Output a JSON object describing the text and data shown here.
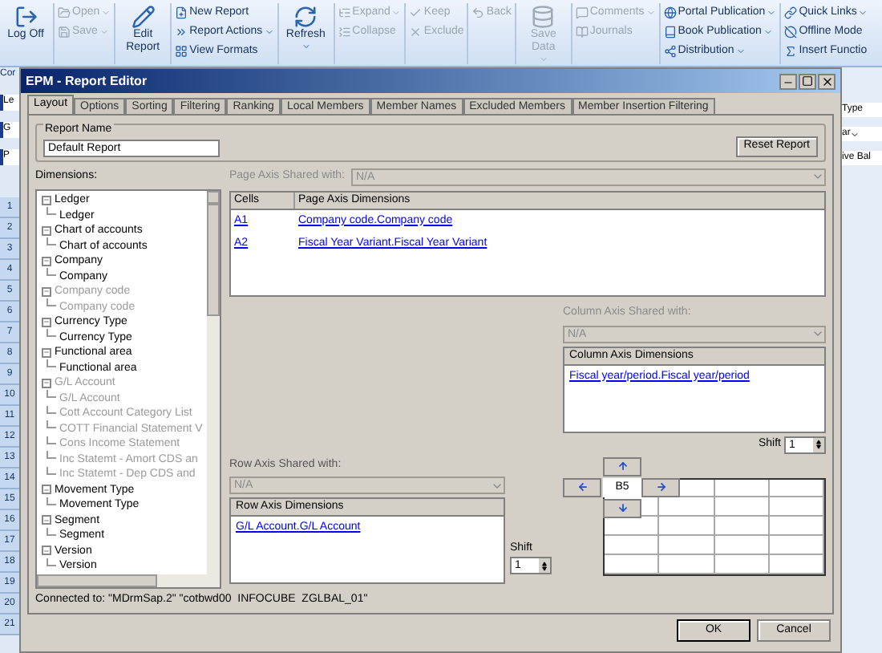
{
  "ribbon": {
    "groups": [
      {
        "items": [
          {
            "kind": "large",
            "label": "Log Off",
            "disabled": false,
            "dropdown": false
          }
        ]
      },
      {
        "items": [
          {
            "kind": "small",
            "label": "Open",
            "disabled": true,
            "dropdown": true
          },
          {
            "kind": "small",
            "label": "Save",
            "disabled": true,
            "dropdown": true
          }
        ]
      },
      {
        "items": [
          {
            "kind": "large",
            "label": "Edit Report",
            "disabled": false,
            "dropdown": false
          }
        ]
      },
      {
        "items": [
          {
            "kind": "small",
            "label": "New Report",
            "disabled": false,
            "dropdown": false
          },
          {
            "kind": "small",
            "label": "Report Actions",
            "disabled": false,
            "dropdown": true
          },
          {
            "kind": "small",
            "label": "View Formats",
            "disabled": false,
            "dropdown": false
          }
        ]
      },
      {
        "items": [
          {
            "kind": "large",
            "label": "Refresh",
            "disabled": false,
            "dropdown": true
          }
        ]
      },
      {
        "items": [
          {
            "kind": "small",
            "label": "Expand",
            "disabled": true,
            "dropdown": true
          },
          {
            "kind": "small",
            "label": "Collapse",
            "disabled": true,
            "dropdown": false
          }
        ]
      },
      {
        "items": [
          {
            "kind": "small",
            "label": "Keep",
            "disabled": true,
            "dropdown": false
          },
          {
            "kind": "small",
            "label": "Exclude",
            "disabled": true,
            "dropdown": false
          }
        ]
      },
      {
        "items": [
          {
            "kind": "small",
            "label": "Back",
            "disabled": true,
            "dropdown": false
          }
        ]
      },
      {
        "items": [
          {
            "kind": "large",
            "label": "Save Data",
            "disabled": true,
            "dropdown": true
          }
        ]
      },
      {
        "items": [
          {
            "kind": "small",
            "label": "Comments",
            "disabled": true,
            "dropdown": true
          },
          {
            "kind": "small",
            "label": "Journals",
            "disabled": true,
            "dropdown": false
          }
        ]
      },
      {
        "items": [
          {
            "kind": "small",
            "label": "Portal Publication",
            "disabled": false,
            "dropdown": true
          },
          {
            "kind": "small",
            "label": "Book Publication",
            "disabled": false,
            "dropdown": true
          },
          {
            "kind": "small",
            "label": "Distribution",
            "disabled": false,
            "dropdown": true
          }
        ]
      },
      {
        "items": [
          {
            "kind": "small",
            "label": "Quick Links",
            "disabled": false,
            "dropdown": true
          },
          {
            "kind": "small",
            "label": "Offline Mode",
            "disabled": false,
            "dropdown": false
          },
          {
            "kind": "small",
            "label": "Insert Functio",
            "disabled": false,
            "dropdown": false
          }
        ]
      }
    ]
  },
  "sheet": {
    "left_tab": "Cor",
    "left_fields": [
      "Le",
      "G",
      "P"
    ],
    "row_numbers": [
      "1",
      "2",
      "3",
      "4",
      "5",
      "6",
      "7",
      "8",
      "9",
      "10",
      "11",
      "12",
      "13",
      "14",
      "15",
      "16",
      "17",
      "18",
      "19",
      "20",
      "21"
    ],
    "right_label": "Type",
    "right_field": "ar",
    "right_text": "ive Bal"
  },
  "dialog": {
    "title": "EPM - Report Editor",
    "tabs": [
      {
        "label": "Layout",
        "selected": true
      },
      {
        "label": "Options",
        "selected": false
      },
      {
        "label": "Sorting",
        "selected": false
      },
      {
        "label": "Filtering",
        "selected": false
      },
      {
        "label": "Ranking",
        "selected": false
      },
      {
        "label": "Local Members",
        "selected": false
      },
      {
        "label": "Member Names",
        "selected": false
      },
      {
        "label": "Excluded Members",
        "selected": false
      },
      {
        "label": "Member Insertion Filtering",
        "selected": false
      }
    ],
    "report_name": {
      "label": "Report Name",
      "value": "Default Report"
    },
    "reset_button": "Reset Report",
    "dimensions": {
      "label": "Dimensions:",
      "tree": [
        {
          "label": "Ledger",
          "disabled": false,
          "children": [
            {
              "label": "Ledger",
              "disabled": false
            }
          ]
        },
        {
          "label": "Chart of accounts",
          "disabled": false,
          "children": [
            {
              "label": "Chart of accounts",
              "disabled": false
            }
          ]
        },
        {
          "label": "Company",
          "disabled": false,
          "children": [
            {
              "label": "Company",
              "disabled": false
            }
          ]
        },
        {
          "label": "Company code",
          "disabled": true,
          "children": [
            {
              "label": "Company code",
              "disabled": true
            }
          ]
        },
        {
          "label": "Currency Type",
          "disabled": false,
          "children": [
            {
              "label": "Currency Type",
              "disabled": false
            }
          ]
        },
        {
          "label": "Functional area",
          "disabled": false,
          "children": [
            {
              "label": "Functional area",
              "disabled": false
            }
          ]
        },
        {
          "label": "G/L Account",
          "disabled": true,
          "children": [
            {
              "label": "G/L Account",
              "disabled": true
            },
            {
              "label": "Cott Account Category List",
              "disabled": true
            },
            {
              "label": "COTT Financial Statement V",
              "disabled": true
            },
            {
              "label": "Cons Income Statement",
              "disabled": true
            },
            {
              "label": "Inc Statemt - Amort CDS an",
              "disabled": true
            },
            {
              "label": "Inc Statemt - Dep CDS and",
              "disabled": true
            }
          ]
        },
        {
          "label": "Movement Type",
          "disabled": false,
          "children": [
            {
              "label": "Movement Type",
              "disabled": false
            }
          ]
        },
        {
          "label": "Segment",
          "disabled": false,
          "children": [
            {
              "label": "Segment",
              "disabled": false
            }
          ]
        },
        {
          "label": "Version",
          "disabled": false,
          "children": [
            {
              "label": "Version",
              "disabled": false
            }
          ]
        }
      ]
    },
    "page_axis": {
      "shared_label": "Page Axis Shared with:",
      "shared_value": "N/A",
      "columns": [
        "Cells",
        "Page Axis Dimensions"
      ],
      "rows": [
        {
          "cell": "A1",
          "dimension": "Company code.Company code"
        },
        {
          "cell": "A2",
          "dimension": "Fiscal Year Variant.Fiscal Year Variant"
        }
      ]
    },
    "column_axis": {
      "shared_label": "Column Axis Shared with:",
      "shared_value": "N/A",
      "column": "Column Axis Dimensions",
      "items": [
        "Fiscal year/period.Fiscal year/period"
      ],
      "shift_label": "Shift",
      "shift_value": "1"
    },
    "row_axis": {
      "shared_label": "Row Axis Shared with:",
      "shared_value": "N/A",
      "column": "Row Axis Dimensions",
      "items": [
        "G/L Account.G/L Account"
      ],
      "shift_label": "Shift",
      "shift_value": "1"
    },
    "navigator": {
      "cell": "B5"
    },
    "status": "Connected to: \"MDrmSap.2\" \"cotbwd00  INFOCUBE  ZGLBAL_01\"",
    "buttons": [
      "OK",
      "Cancel"
    ]
  }
}
